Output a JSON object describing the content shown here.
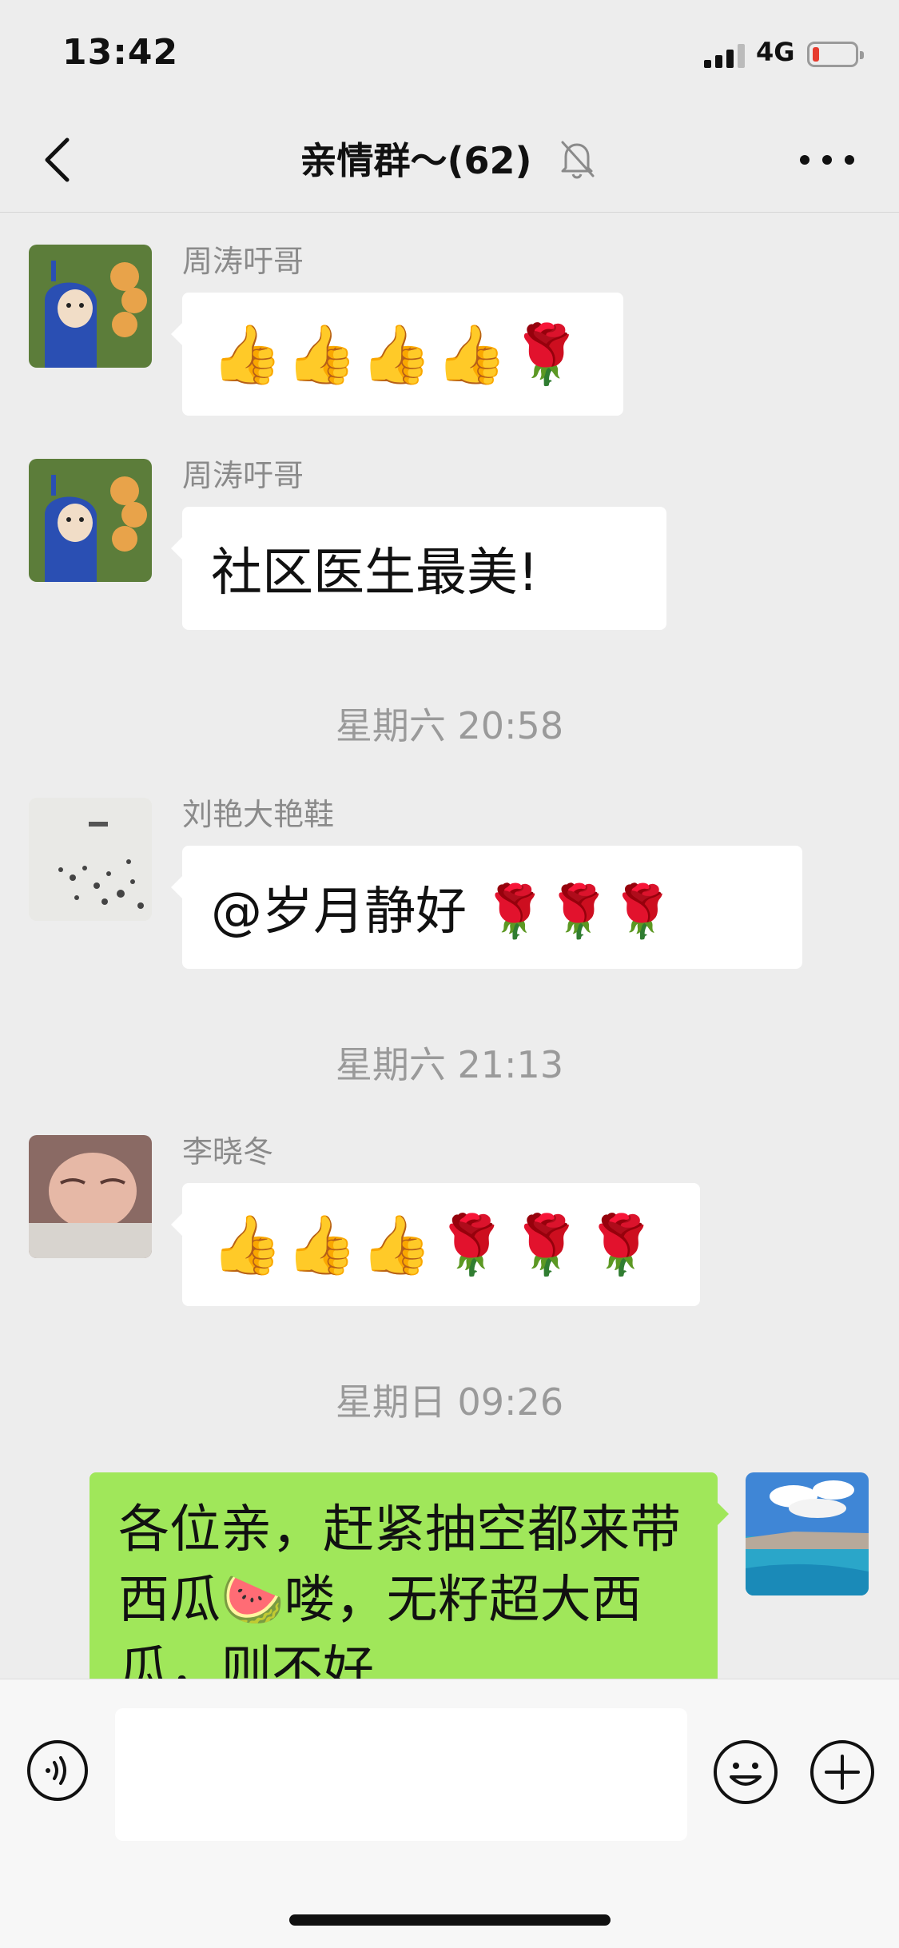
{
  "status_bar": {
    "time": "13:42",
    "network": "4G"
  },
  "nav": {
    "title": "亲情群～(62)"
  },
  "messages": [
    {
      "sender": "周涛吁哥",
      "content": "👍👍👍👍🌹"
    },
    {
      "sender": "周涛吁哥",
      "content": "社区医生最美!"
    },
    {
      "time": "星期六 20:58"
    },
    {
      "sender": "刘艳大艳鞋",
      "content": "@岁月静好 🌹🌹🌹"
    },
    {
      "time": "星期六 21:13"
    },
    {
      "sender": "李晓冬",
      "content": "👍👍👍🌹🌹🌹"
    },
    {
      "time": "星期日 09:26"
    },
    {
      "content": "各位亲，赶紧抽空都来带西瓜🍉喽，无籽超大西瓜，则不好"
    }
  ],
  "colors": {
    "me_bubble": "#a0e75a",
    "background": "#ededed"
  },
  "icons": [
    "back-arrow-icon",
    "mute-bell-icon",
    "more-icon",
    "voice-icon",
    "emoji-icon",
    "plus-icon"
  ]
}
